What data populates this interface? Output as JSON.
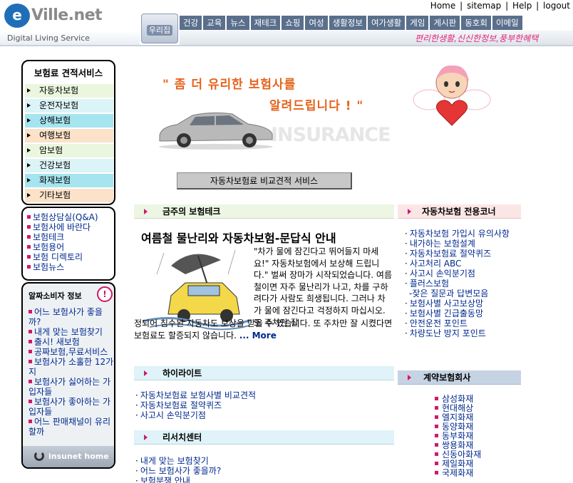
{
  "header": {
    "logo_e": "e",
    "logo_text": "Ville.net",
    "slogan": "Digital Living Service",
    "top_links": [
      "Home",
      "sitemap",
      "Help",
      "logout"
    ],
    "woori_label": "우리집",
    "nav": [
      "건강",
      "교육",
      "뉴스",
      "재테크",
      "쇼핑",
      "여성",
      "생활정보",
      "여가생활",
      "게임",
      "게시판",
      "동호회",
      "이메일"
    ],
    "tagline": "편리한생활,신신한정보,풍부한혜택"
  },
  "sidebar": {
    "title": "보험료 견적서비스",
    "items": [
      {
        "label": "자동차보험",
        "color": "#eaf6dd"
      },
      {
        "label": "운전자보험",
        "color": "#dcf3f7"
      },
      {
        "label": "상해보험",
        "color": "#a6e4ef"
      },
      {
        "label": "여행보험",
        "color": "#fbe2c9"
      },
      {
        "label": "암보험",
        "color": "#eaf6dd"
      },
      {
        "label": "건강보험",
        "color": "#dcf3f7"
      },
      {
        "label": "화재보험",
        "color": "#a6e4ef"
      },
      {
        "label": "기타보험",
        "color": "#fbe2c9"
      }
    ],
    "links": [
      "보험상담실(Q&A)",
      "보험사에 바란다",
      "보험테크",
      "보험용어",
      "보험 디렉토리",
      "보험뉴스"
    ],
    "info_title": "알짜소비자 정보",
    "info_excl": "!",
    "info_items": [
      "어느 보험사가 좋을까?",
      "내게 맞는 보험찾기",
      "출시! 새보험",
      "공짜보험,무료서비스",
      "보험사가 소홀한 12가지",
      "보험사가 싫어하는 가입자들",
      "보험사가 좋아하는 가입자들",
      "어느 판매채널이 유리할까"
    ],
    "home_label": "insunet home"
  },
  "hero": {
    "line1": "\" 좀 더 유리한 보험사를",
    "line2": "알려드립니다 ! \"",
    "watermark": "INSURANCE",
    "compare_button": "자동차보험료 비교견적 서비스"
  },
  "notable": {
    "heading": "금주의 보험테크",
    "article_title": "여름철 물난리와 자동차보험-문답식 안내",
    "article_body": "\"차가 물에 잠긴다고 뛰어들지 마세요!\" 자동차보험에서 보상해 드립니다.\" 벌써 장마가 시작되었습니다. 여름철이면 자주 물난리가 나고, 차를 구하려다가 사람도 희생됩니다. 그러나 차가 물에 잠긴다고 걱정하지 마십시오. 또 주차만 잘",
    "article_body_pre": "정되어 침수된 자동차도 보상을 받을 수 있습니다. 또 주차만 잘 시켰다면 보험료도 할증되지 않습니다.",
    "more": "... More"
  },
  "highlight": {
    "heading": "하이라이트",
    "items": [
      "자동차보험료 보험사별 비교견적",
      "자동차보험료 절약퀴즈",
      "사고시 손익분기점"
    ]
  },
  "research": {
    "heading": "리서치센터",
    "items": [
      "내게 맞는 보험찾기",
      "어느 보험사가 좋을까?",
      "보험분쟁 안내"
    ]
  },
  "auto_corner": {
    "heading": "자동차보험 전용코너",
    "items": [
      "자동차보험 가입시 유의사항",
      "내가하는 보험설계",
      "자동차보험료 절약퀴즈",
      "사고처리 ABC",
      "사고시 손익분기점",
      "플러스보험",
      "-잦은 질문과 답변모음",
      "보험사별 사고보상망",
      "보험사별 긴급출동망",
      "안전운전 포인트",
      "차량도난 방지 포인트"
    ]
  },
  "contract": {
    "heading": "계약보험회사",
    "items": [
      "삼성화재",
      "현대해상",
      "엘지화재",
      "동양화재",
      "동부화재",
      "쌍용화재",
      "신동아화재",
      "제일화재",
      "국제화재"
    ]
  }
}
